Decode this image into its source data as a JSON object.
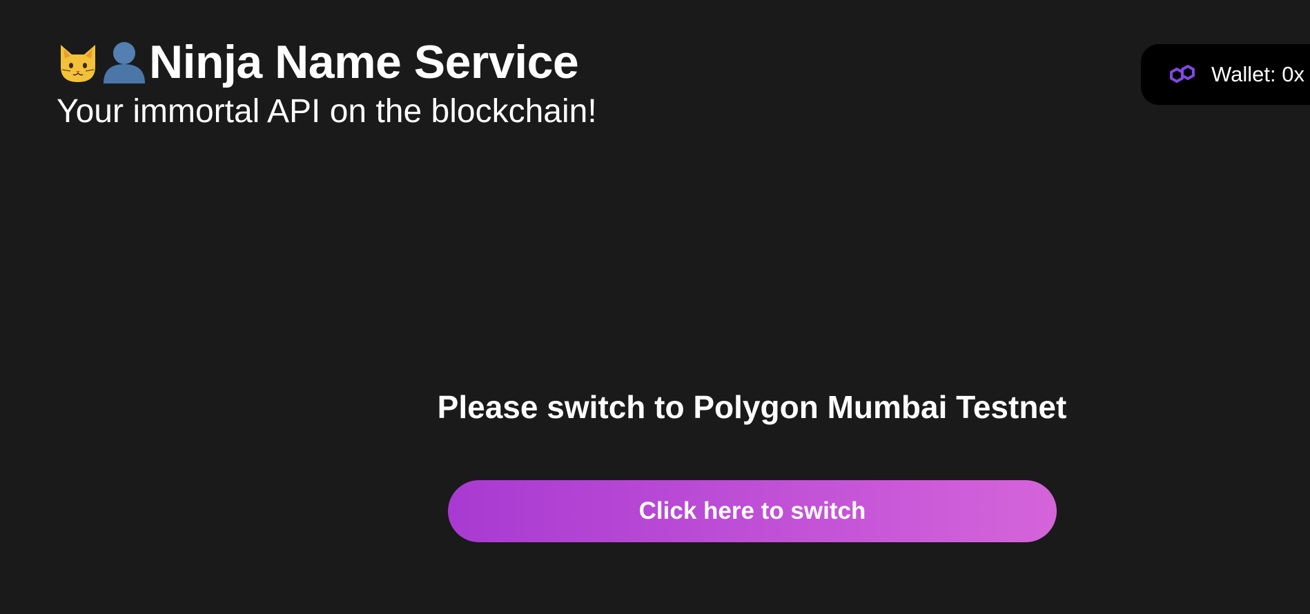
{
  "header": {
    "title": "Ninja Name Service",
    "subtitle": "Your immortal API on the blockchain!",
    "icons": [
      "cat-face-icon",
      "user-silhouette-icon"
    ]
  },
  "wallet": {
    "label": "Wallet: 0x",
    "icon": "polygon-icon",
    "accent_color": "#8247e5"
  },
  "network_notice": {
    "message": "Please switch to Polygon Mumbai Testnet",
    "button_label": "Click here to switch",
    "button_gradient": [
      "#a83ad2",
      "#d564da"
    ]
  },
  "theme": {
    "background": "#1a1a1a",
    "text": "#ffffff"
  }
}
